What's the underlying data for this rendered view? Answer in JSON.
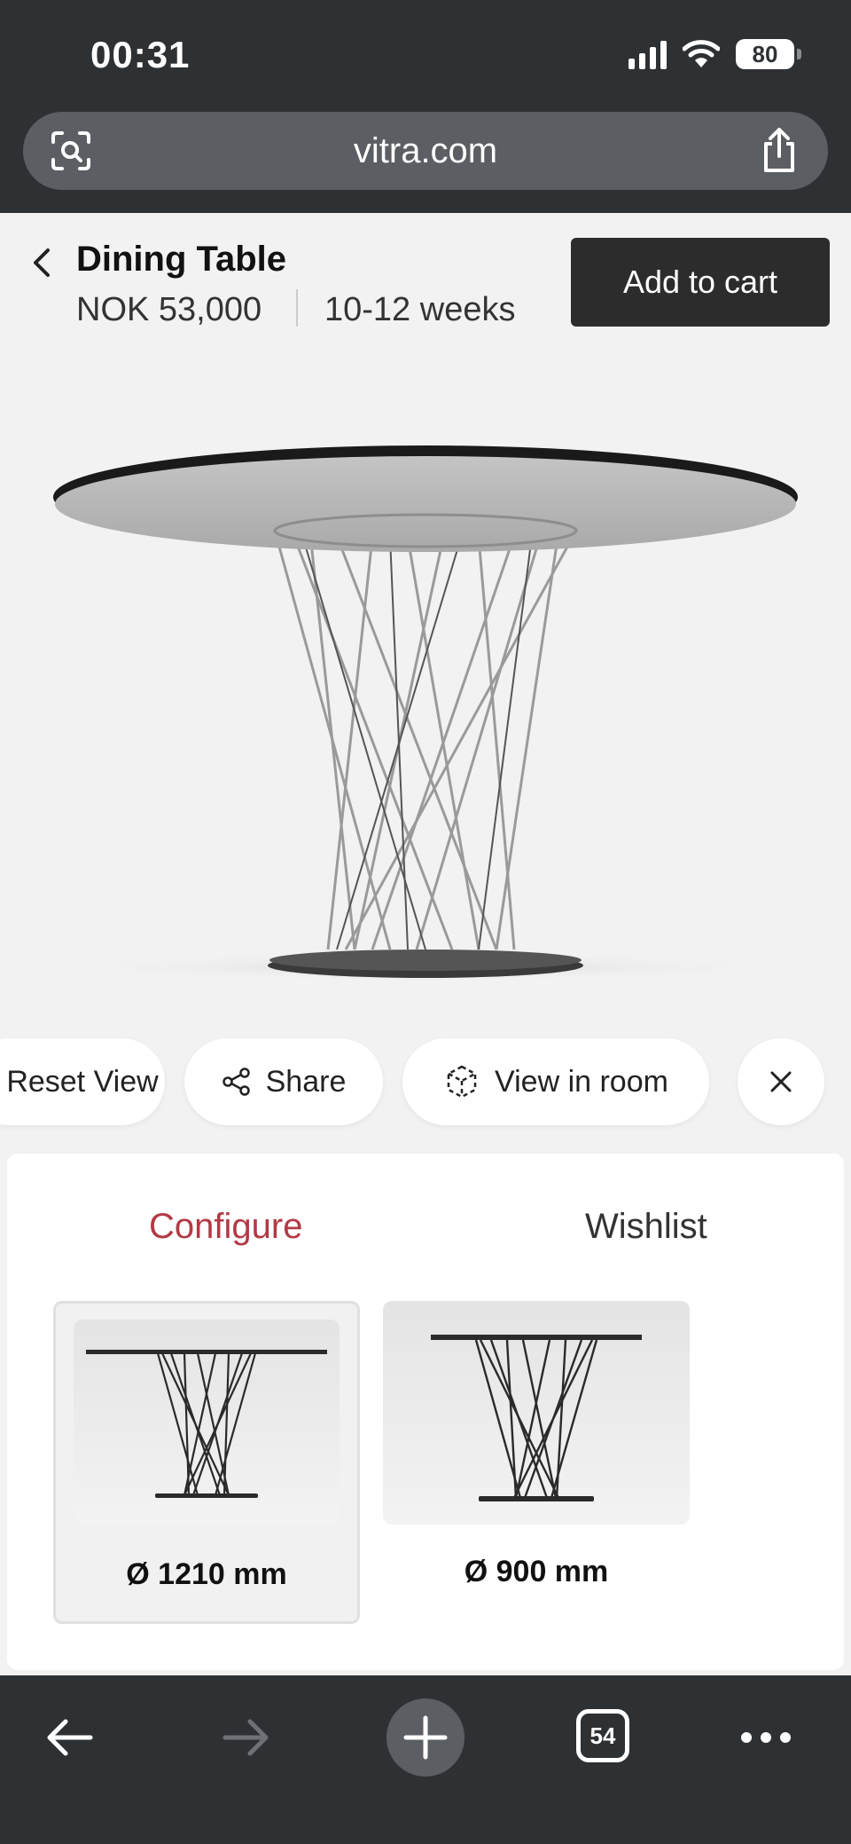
{
  "status_bar": {
    "time": "00:31",
    "battery": "80"
  },
  "browser": {
    "url": "vitra.com",
    "open_tabs": "54"
  },
  "product": {
    "title": "Dining Table",
    "price": "NOK 53,000",
    "delivery": "10-12 weeks",
    "add_to_cart_label": "Add to cart"
  },
  "actions": {
    "reset_label": "Reset View",
    "share_label": "Share",
    "view_in_room_label": "View in room"
  },
  "tabs": {
    "configure_label": "Configure",
    "wishlist_label": "Wishlist",
    "active": "Configure",
    "active_color": "#b23a45"
  },
  "options": [
    {
      "label": "Ø 1210 mm",
      "selected": true
    },
    {
      "label": "Ø 900 mm",
      "selected": false
    }
  ],
  "icons": {
    "url_left": "camera-search-icon",
    "url_right": "share-icon",
    "back": "chevron-left-icon",
    "share": "share-nodes-icon",
    "view_in_room": "ar-cube-icon",
    "close": "close-icon",
    "toolbar": [
      "arrow-left-icon",
      "arrow-right-icon",
      "plus-icon",
      "tabs-icon",
      "more-icon"
    ]
  }
}
